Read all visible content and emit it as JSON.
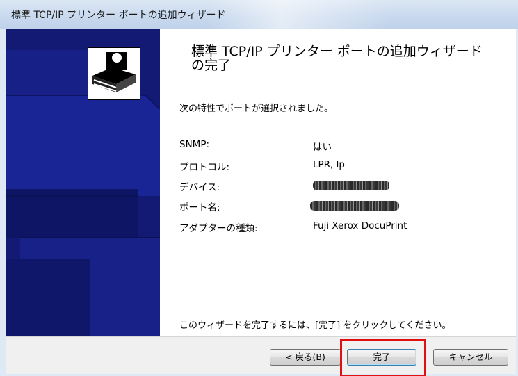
{
  "window": {
    "title": "標準 TCP/IP プリンター ポートの追加ウィザード"
  },
  "content": {
    "heading": "標準 TCP/IP プリンター ポートの追加ウィザード の完了",
    "intro": "次の特性でポートが選択されました。",
    "properties": [
      {
        "label": "SNMP:",
        "value": "はい"
      },
      {
        "label": "プロトコル:",
        "value": "LPR, lp"
      },
      {
        "label": "デバイス:",
        "value": "",
        "redacted": true
      },
      {
        "label": "ポート名:",
        "value": "",
        "redacted": true
      },
      {
        "label": "アダプターの種類:",
        "value": "Fuji Xerox DocuPrint"
      }
    ],
    "footer": "このウィザードを完了するには、[完了] をクリックしてください。"
  },
  "buttons": {
    "back": "< 戻る(B)",
    "finish": "完了",
    "cancel": "キャンセル"
  },
  "colors": {
    "banner": "#121a73",
    "highlight": "#e01010"
  },
  "icons": {
    "wizard": "printer-port-icon"
  }
}
